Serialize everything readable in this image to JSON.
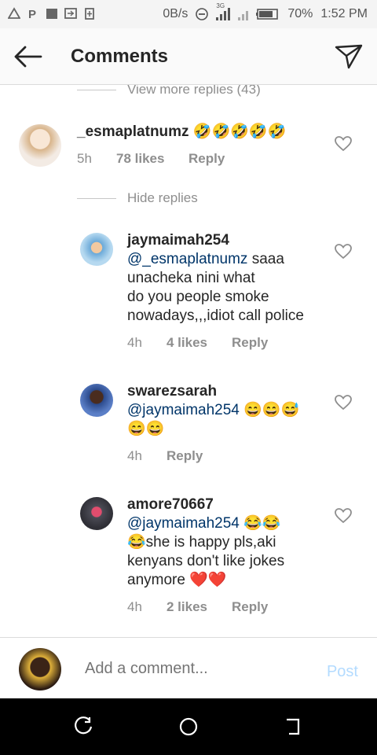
{
  "status_bar": {
    "network_speed": "0B/s",
    "network_type": "3G",
    "battery": "70%",
    "time": "1:52 PM",
    "left_icons": [
      "warning-icon",
      "p-icon",
      "square-icon",
      "cast-icon",
      "battery-saver-icon"
    ]
  },
  "header": {
    "title": "Comments"
  },
  "view_more_replies": "View more replies (43)",
  "hide_replies": "Hide replies",
  "parent_comment": {
    "username": "_esmaplatnumz",
    "emoji": "🤣🤣🤣🤣🤣",
    "time": "5h",
    "likes": "78 likes",
    "reply": "Reply"
  },
  "replies": [
    {
      "username": "jaymaimah254",
      "mention": "@_esmaplatnumz",
      "line1_rest": " saaa",
      "line2": "unacheka nini what",
      "line3": "do you people smoke",
      "line4": "nowadays,,,idiot call police",
      "time": "4h",
      "likes": "4 likes",
      "reply": "Reply"
    },
    {
      "username": "swarezsarah",
      "mention": "@jaymaimah254",
      "line1_rest": " 😄😄😅",
      "line2": "😄😄",
      "time": "4h",
      "reply": "Reply"
    },
    {
      "username": "amore70667",
      "mention": "@jaymaimah254",
      "line1_rest": " 😂😂",
      "line2": "😂she is happy pls,aki",
      "line3": "kenyans don't like jokes",
      "line4": "anymore ❤️❤️",
      "time": "4h",
      "likes": "2 likes",
      "reply": "Reply"
    }
  ],
  "input": {
    "placeholder": "Add a comment...",
    "post_label": "Post"
  },
  "colors": {
    "mention": "#003569",
    "muted": "#8e8e8e",
    "post_disabled": "#b3dbff"
  }
}
